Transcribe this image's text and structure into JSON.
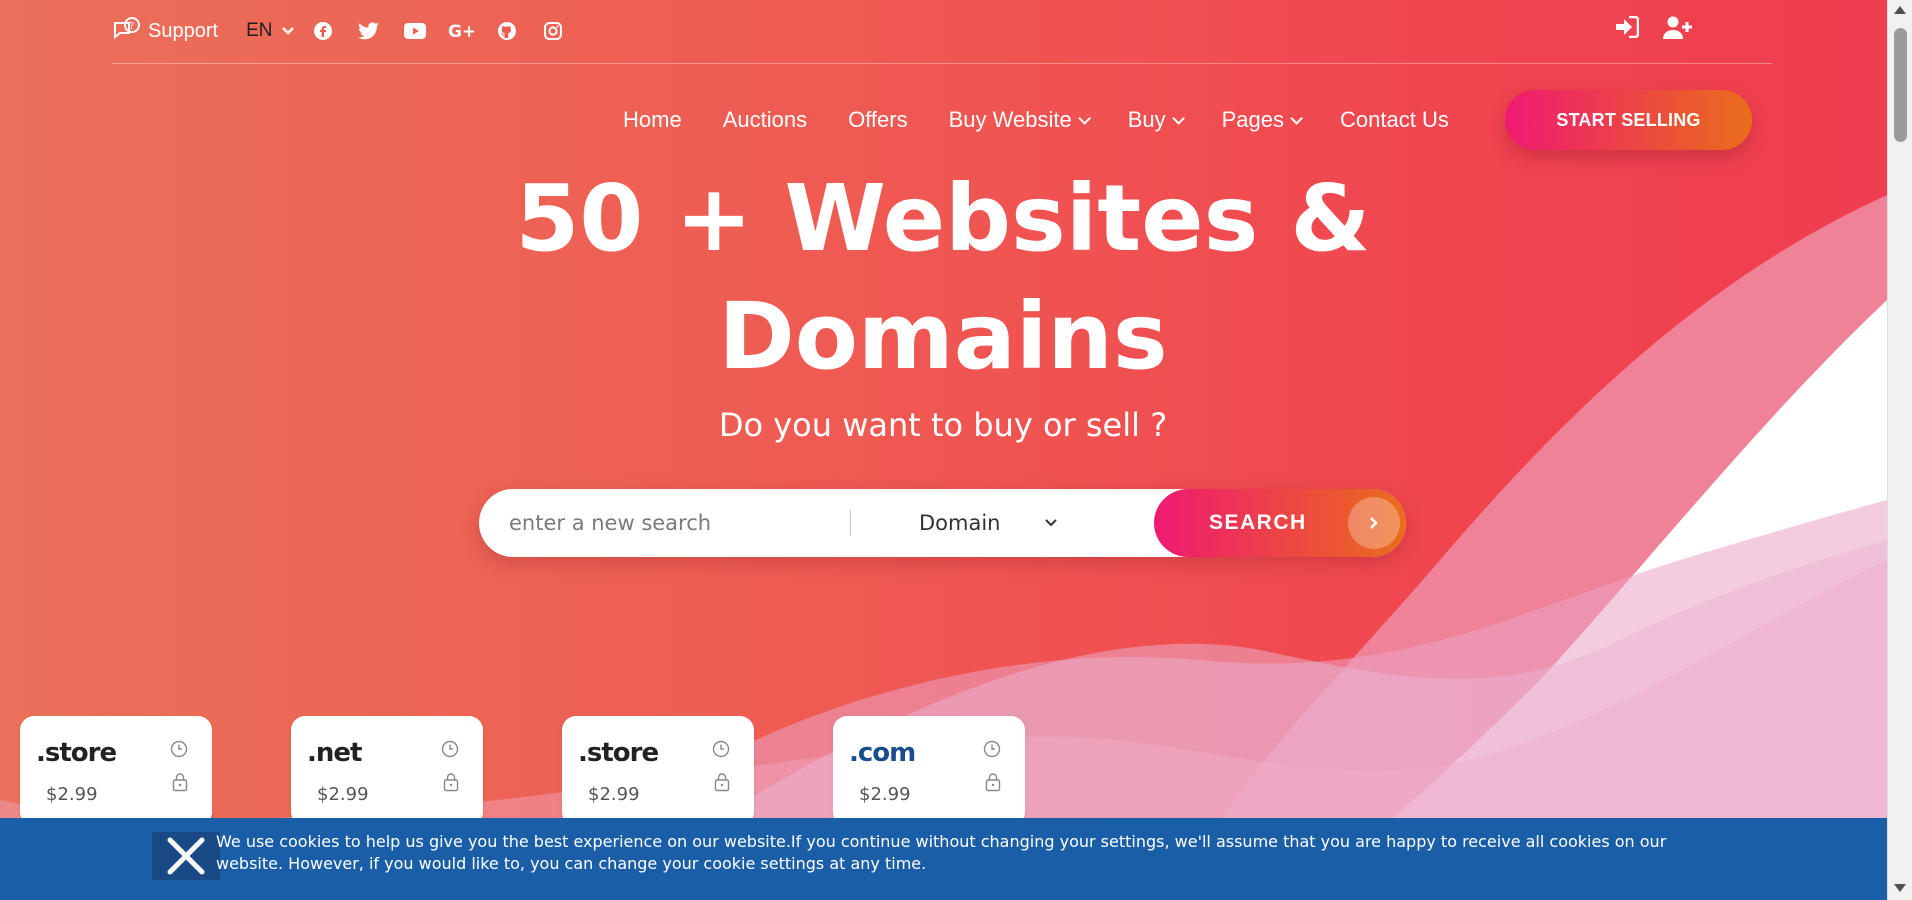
{
  "topbar": {
    "support_label": "Support",
    "language": "EN",
    "social_icons": [
      "facebook-icon",
      "twitter-icon",
      "youtube-icon",
      "google-plus-icon",
      "github-icon",
      "instagram-icon"
    ],
    "account_icons": [
      "sign-in-icon",
      "user-plus-icon"
    ]
  },
  "nav": {
    "items": [
      {
        "label": "Home",
        "dropdown": false
      },
      {
        "label": "Auctions",
        "dropdown": false
      },
      {
        "label": "Offers",
        "dropdown": false
      },
      {
        "label": "Buy Website",
        "dropdown": true
      },
      {
        "label": "Buy",
        "dropdown": true
      },
      {
        "label": "Pages",
        "dropdown": true
      },
      {
        "label": "Contact Us",
        "dropdown": false
      }
    ],
    "cta_label": "START SELLING"
  },
  "hero": {
    "headline_line1": "50 + Websites &",
    "headline_line2": "Domains",
    "subline": "Do you want to buy or sell ?"
  },
  "search": {
    "placeholder": "enter a new search",
    "select_value": "Domain",
    "button_label": "SEARCH"
  },
  "cards": [
    {
      "tld": ".store",
      "price": "$2.99"
    },
    {
      "tld": ".net",
      "price": "$2.99"
    },
    {
      "tld": ".store",
      "price": "$2.99"
    },
    {
      "tld": ".com",
      "price": "$2.99"
    }
  ],
  "cookie": {
    "text": "We use cookies to help us give you the best experience on our website.If you continue without changing your settings, we'll assume that you are happy to receive all cookies on our website. However, if you would like to, you can change your cookie settings at any time."
  },
  "colors": {
    "hero_start": "#ea7059",
    "hero_end": "#ef3e4f",
    "cta_start": "#ef1a72",
    "cta_end": "#ea6d1a",
    "cookie_bg": "#1b5ea8"
  }
}
